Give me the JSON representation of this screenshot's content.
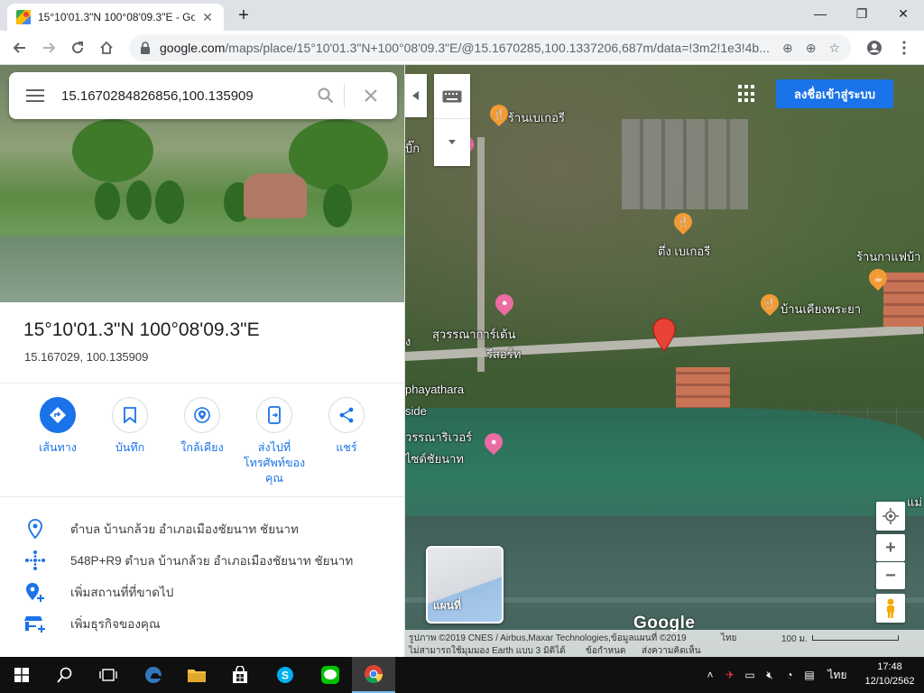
{
  "browser": {
    "tab_title": "15°10'01.3\"N 100°08'09.3\"E - Go",
    "tab_close": "✕",
    "new_tab": "+",
    "win_minimize": "—",
    "win_restore": "❐",
    "win_close": "✕",
    "url_host": "google.com",
    "url_path": "/maps/place/15°10'01.3\"N+100°08'09.3\"E/@15.1670285,100.1337206,687m/data=!3m2!1e3!4b..."
  },
  "search": {
    "value": "15.1670284826856,100.135909"
  },
  "place": {
    "title": "15°10'01.3\"N 100°08'09.3\"E",
    "coords": "15.167029, 100.135909"
  },
  "actions": [
    {
      "label": "เส้นทาง"
    },
    {
      "label": "บันทึก"
    },
    {
      "label": "ใกล้เคียง"
    },
    {
      "label": "ส่งไปที่\nโทรศัพท์ของ\nคุณ"
    },
    {
      "label": "แชร์"
    }
  ],
  "info": [
    {
      "text": "ตำบล บ้านกล้วย อำเภอเมืองชัยนาท ชัยนาท"
    },
    {
      "text": "548P+R9 ตำบล บ้านกล้วย อำเภอเมืองชัยนาท ชัยนาท"
    },
    {
      "text": "เพิ่มสถานที่ที่ขาดไป"
    },
    {
      "text": "เพิ่มธุรกิจของคุณ"
    }
  ],
  "map": {
    "signin_label": "ลงชื่อเข้าสู่ระบบ",
    "labels": [
      "ร้านเบเกอรี",
      "บิ๊ก",
      "ตึ่ง เบเกอรี",
      "ร้านกาแฟบ้า",
      "บ้านเคียงพระยา",
      "สุวรรณาการ์เด้น",
      "รีสอร์ท",
      "phayathara",
      "side",
      "วรรณาริเวอร์",
      "ไซด์ชัยนาท",
      "ง",
      "แม่"
    ],
    "minimap_label": "แผนที่",
    "google": "Google",
    "attribution_1": "รูปภาพ ©2019 CNES / Airbus,Maxar Technologies,ข้อมูลแผนที่ ©2019",
    "attribution_lang": "ไทย",
    "attribution_2": "ไม่สามารถใช้มุมมอง Earth แบบ 3 มิติได้",
    "terms": "ข้อกำหนด",
    "feedback": "ส่งความคิดเห็น",
    "scale": "100 ม.",
    "zoom_in": "+",
    "zoom_out": "−"
  },
  "taskbar": {
    "lang": "ไทย",
    "time": "17:48",
    "date": "12/10/2562"
  },
  "colors": {
    "accent": "#1a73e8",
    "pin": "#ea4335",
    "poi_food": "#f29b34",
    "poi_pink": "#e96ca2"
  }
}
